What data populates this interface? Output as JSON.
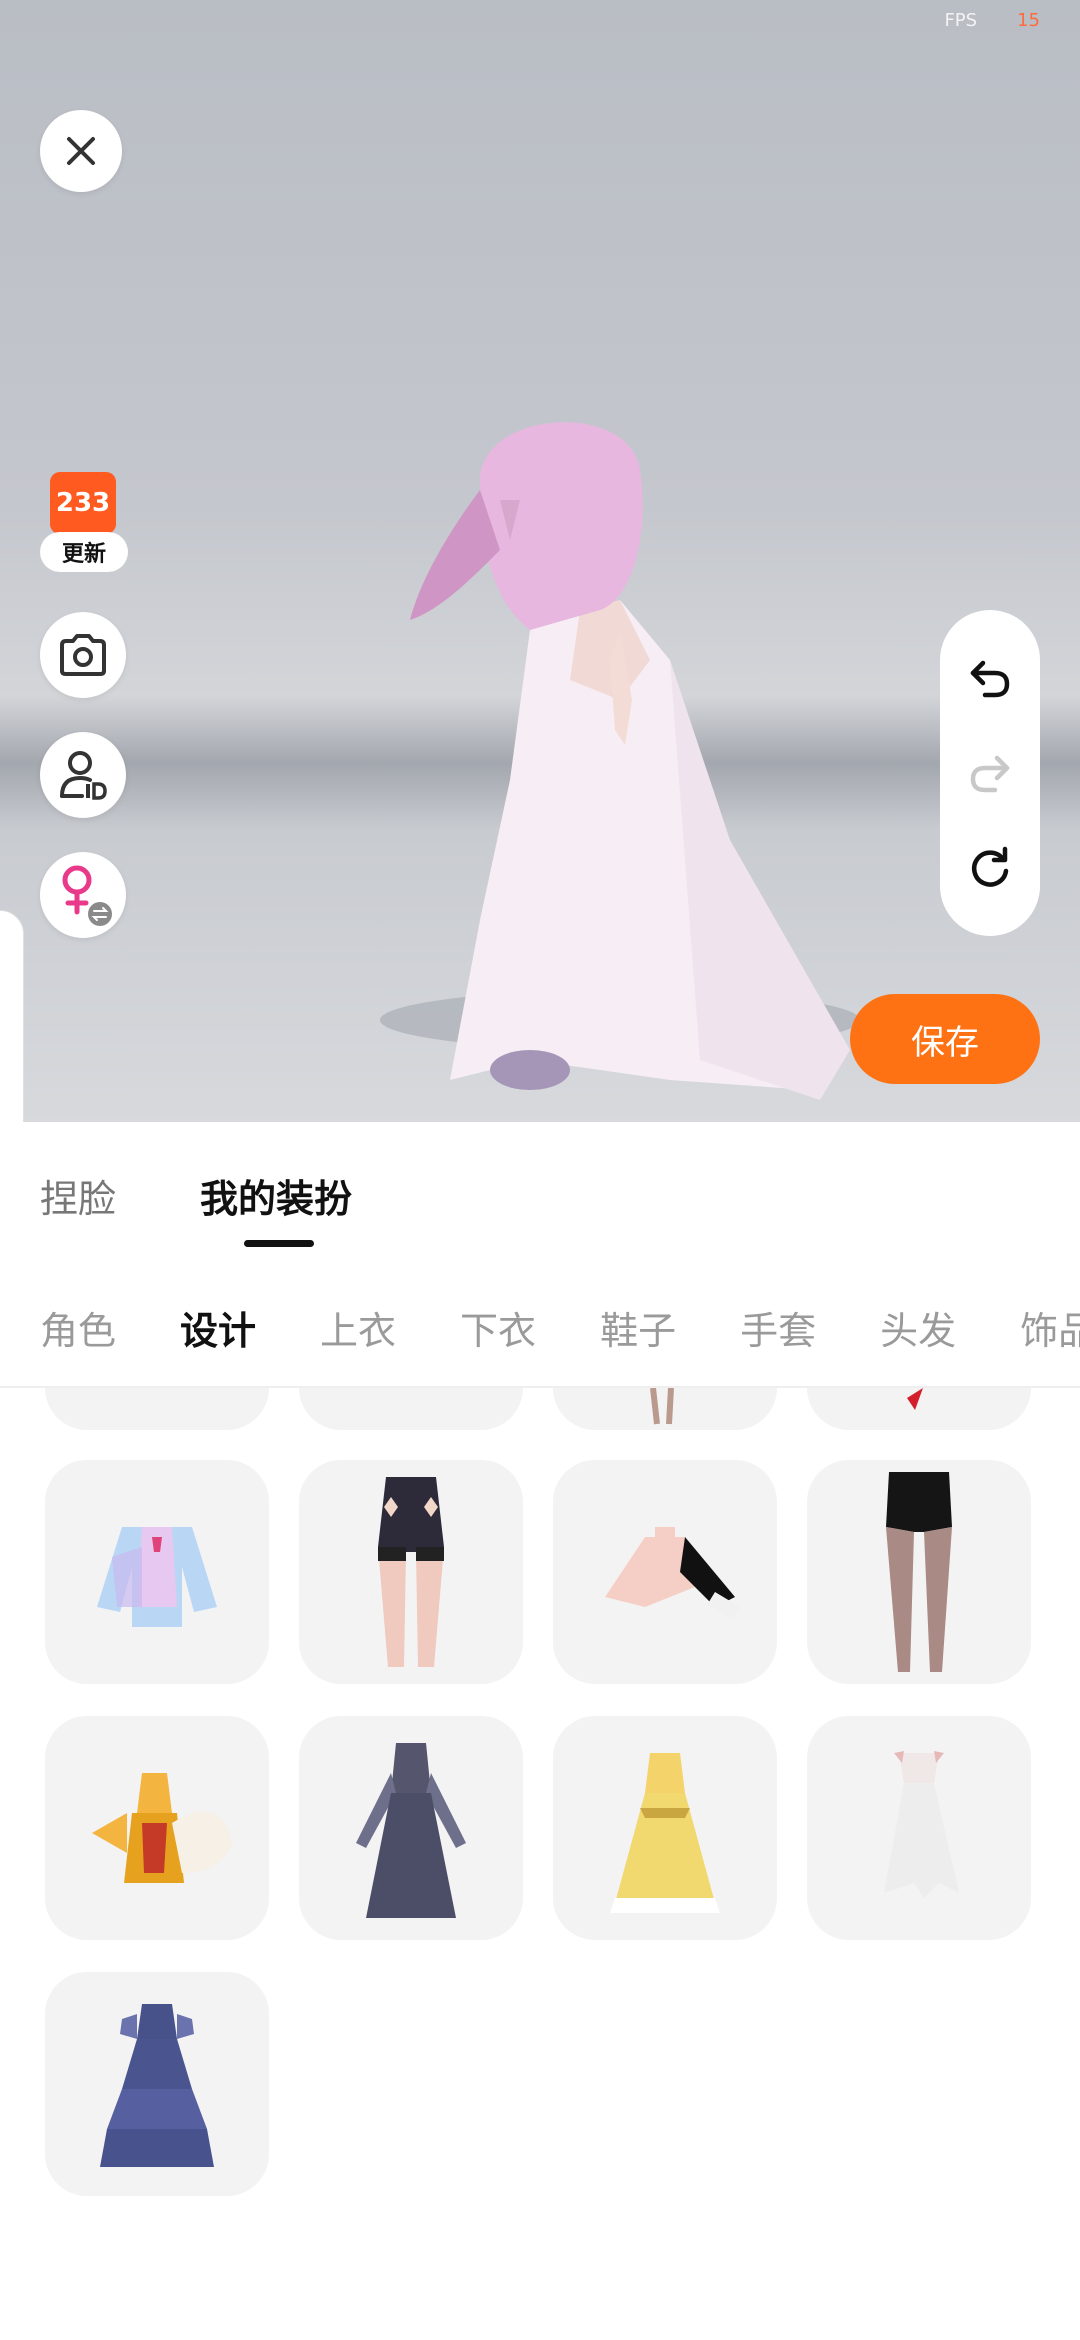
{
  "fps": {
    "label": "FPS",
    "value": "15"
  },
  "badge": {
    "logo_text": "233",
    "label": "更新"
  },
  "actions": {
    "save_label": "保存"
  },
  "main_tabs": [
    {
      "label": "捏脸",
      "active": false
    },
    {
      "label": "我的装扮",
      "active": true
    }
  ],
  "categories": [
    {
      "label": "角色",
      "active": false
    },
    {
      "label": "设计",
      "active": true
    },
    {
      "label": "上衣",
      "active": false
    },
    {
      "label": "下衣",
      "active": false
    },
    {
      "label": "鞋子",
      "active": false
    },
    {
      "label": "手套",
      "active": false
    },
    {
      "label": "头发",
      "active": false
    },
    {
      "label": "饰品",
      "active": false
    }
  ],
  "icons": {
    "close": "close-icon",
    "camera": "camera-icon",
    "avatar_id": "avatar-id-icon",
    "gender_switch": "female-switch-icon",
    "undo": "undo-icon",
    "redo": "redo-icon",
    "reset": "reset-icon"
  },
  "items": [
    "pastel jacket",
    "lace stockings shorts",
    "asymmetric black top",
    "black shorts tights",
    "orange fox-tail outfit",
    "navy long gown",
    "yellow layered dress",
    "white off-shoulder dress",
    "navy tiered dress"
  ],
  "colors": {
    "accent": "#ff7213",
    "badge": "#ff5a1f",
    "fps_value": "#ff6b3d"
  }
}
